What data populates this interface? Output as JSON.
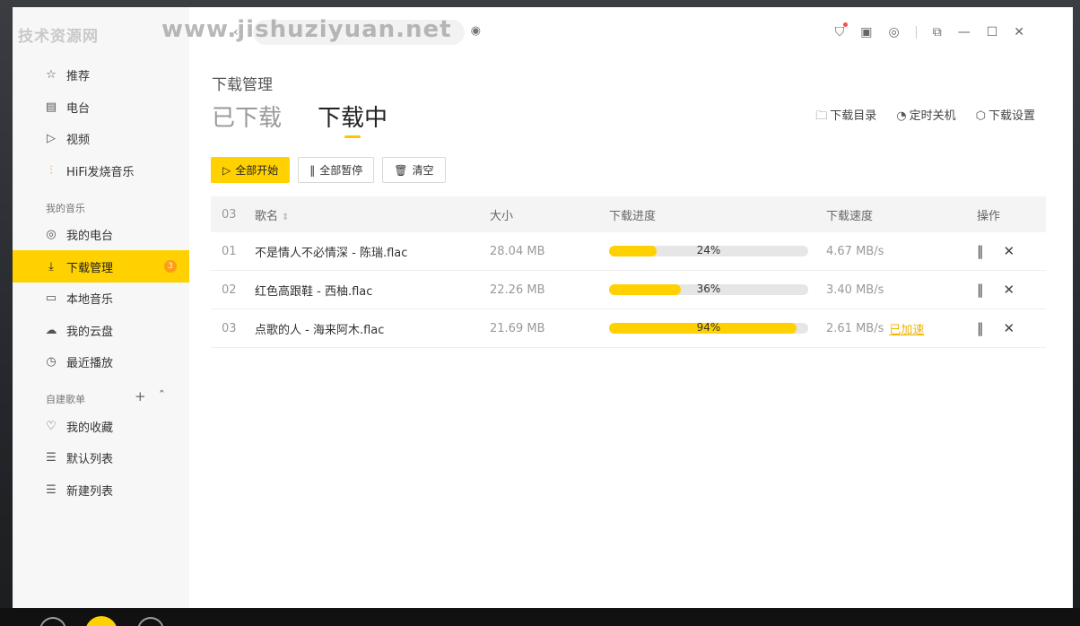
{
  "logo_text": "技术资源网",
  "watermark": "www.jishuziyuan.net",
  "sidebar": {
    "top_items": [
      {
        "label": "推荐",
        "icon": "star-icon"
      },
      {
        "label": "电台",
        "icon": "radio-icon"
      },
      {
        "label": "视频",
        "icon": "video-icon"
      },
      {
        "label": "HiFi发烧音乐",
        "icon": "waveform-icon"
      }
    ],
    "my_music_title": "我的音乐",
    "my_music_items": [
      {
        "label": "我的电台",
        "icon": "station-icon"
      },
      {
        "label": "下载管理",
        "icon": "download-icon",
        "badge": "3"
      },
      {
        "label": "本地音乐",
        "icon": "monitor-icon"
      },
      {
        "label": "我的云盘",
        "icon": "cloud-icon"
      },
      {
        "label": "最近播放",
        "icon": "clock-icon"
      }
    ],
    "playlists_title": "自建歌单",
    "playlist_items": [
      {
        "label": "我的收藏",
        "icon": "heart-icon"
      },
      {
        "label": "默认列表",
        "icon": "playlist-icon"
      },
      {
        "label": "新建列表",
        "icon": "playlist-icon"
      }
    ]
  },
  "page": {
    "crumb": "下载管理",
    "tabs": [
      "已下载",
      "下载中"
    ],
    "active_tab": 1,
    "right_links": [
      {
        "label": "下载目录",
        "icon": "folder-icon"
      },
      {
        "label": "定时关机",
        "icon": "timer-icon"
      },
      {
        "label": "下载设置",
        "icon": "settings-icon"
      }
    ],
    "actions": {
      "start_all": "全部开始",
      "pause_all": "全部暂停",
      "clear": "清空"
    }
  },
  "table": {
    "count": "03",
    "headers": {
      "name": "歌名",
      "size": "大小",
      "progress": "下载进度",
      "speed": "下载速度",
      "ops": "操作"
    },
    "rows": [
      {
        "idx": "01",
        "name": "不是情人不必情深 - 陈瑞.flac",
        "size": "28.04 MB",
        "progress": 24,
        "progress_label": "24%",
        "speed": "4.67 MB/s",
        "accel": ""
      },
      {
        "idx": "02",
        "name": "红色高跟鞋 - 西柚.flac",
        "size": "22.26 MB",
        "progress": 36,
        "progress_label": "36%",
        "speed": "3.40 MB/s",
        "accel": ""
      },
      {
        "idx": "03",
        "name": "点歌的人 - 海来阿木.flac",
        "size": "21.69 MB",
        "progress": 94,
        "progress_label": "94%",
        "speed": "2.61 MB/s",
        "accel": "已加速"
      }
    ]
  },
  "colors": {
    "accent": "#ffd100",
    "badge": "#ff9b1a"
  }
}
